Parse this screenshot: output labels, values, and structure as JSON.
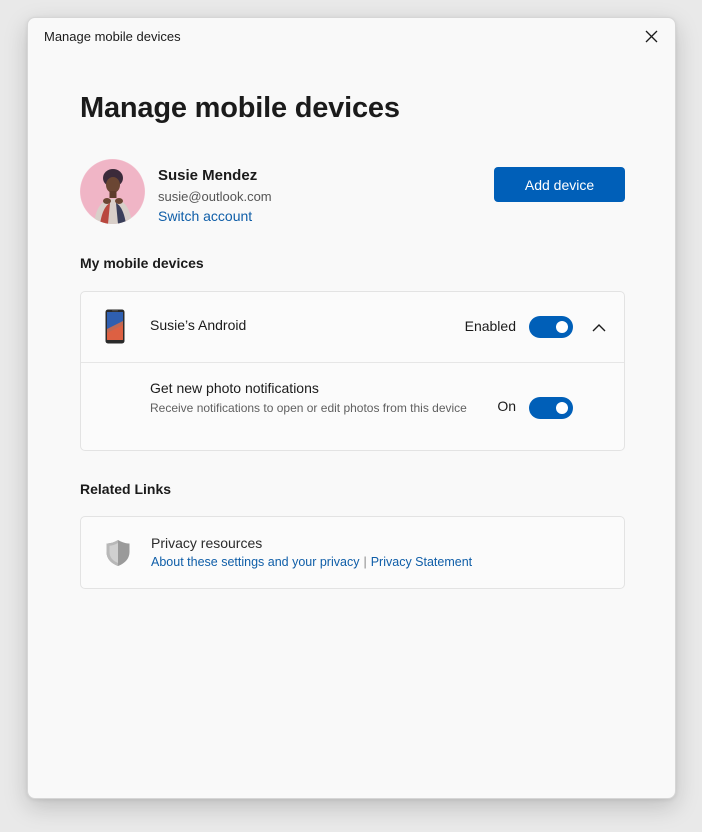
{
  "window": {
    "title": "Manage mobile devices"
  },
  "page": {
    "title": "Manage mobile devices"
  },
  "account": {
    "name": "Susie Mendez",
    "email": "susie@outlook.com",
    "switch_label": "Switch account",
    "add_device_label": "Add device"
  },
  "devices_section": {
    "title": "My mobile devices",
    "device": {
      "name": "Susie’s Android",
      "status": "Enabled",
      "enabled": true,
      "expanded": true,
      "setting": {
        "title": "Get new photo notifications",
        "description": "Receive notifications to open or edit photos from this device",
        "status": "On",
        "enabled": true
      }
    }
  },
  "related_links": {
    "title": "Related Links",
    "privacy": {
      "title": "Privacy resources",
      "link_about": "About these settings and your privacy",
      "separator": "|",
      "link_statement": "Privacy Statement"
    }
  },
  "icons": {
    "close": "close-icon",
    "phone": "phone-icon",
    "chevron": "chevron-up-icon",
    "shield": "shield-icon"
  },
  "colors": {
    "accent": "#005fb8",
    "link": "#0f5ea8",
    "window_bg": "#f9f9f9",
    "card_bg": "#fbfbfb"
  }
}
